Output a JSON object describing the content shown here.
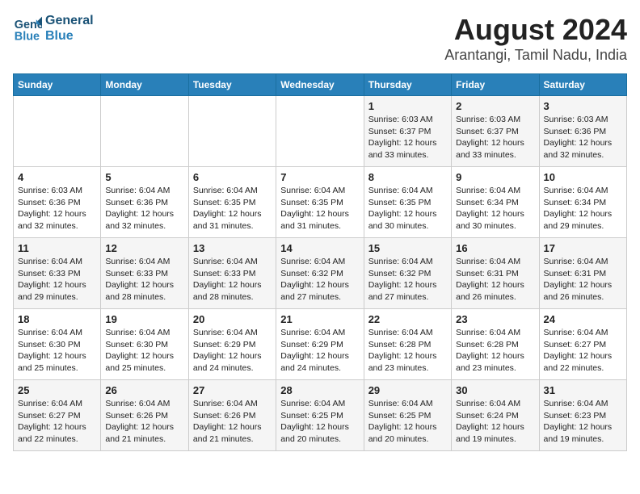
{
  "logo": {
    "line1": "General",
    "line2": "Blue"
  },
  "title": "August 2024",
  "subtitle": "Arantangi, Tamil Nadu, India",
  "days_of_week": [
    "Sunday",
    "Monday",
    "Tuesday",
    "Wednesday",
    "Thursday",
    "Friday",
    "Saturday"
  ],
  "weeks": [
    [
      {
        "day": "",
        "info": ""
      },
      {
        "day": "",
        "info": ""
      },
      {
        "day": "",
        "info": ""
      },
      {
        "day": "",
        "info": ""
      },
      {
        "day": "1",
        "info": "Sunrise: 6:03 AM\nSunset: 6:37 PM\nDaylight: 12 hours\nand 33 minutes."
      },
      {
        "day": "2",
        "info": "Sunrise: 6:03 AM\nSunset: 6:37 PM\nDaylight: 12 hours\nand 33 minutes."
      },
      {
        "day": "3",
        "info": "Sunrise: 6:03 AM\nSunset: 6:36 PM\nDaylight: 12 hours\nand 32 minutes."
      }
    ],
    [
      {
        "day": "4",
        "info": "Sunrise: 6:03 AM\nSunset: 6:36 PM\nDaylight: 12 hours\nand 32 minutes."
      },
      {
        "day": "5",
        "info": "Sunrise: 6:04 AM\nSunset: 6:36 PM\nDaylight: 12 hours\nand 32 minutes."
      },
      {
        "day": "6",
        "info": "Sunrise: 6:04 AM\nSunset: 6:35 PM\nDaylight: 12 hours\nand 31 minutes."
      },
      {
        "day": "7",
        "info": "Sunrise: 6:04 AM\nSunset: 6:35 PM\nDaylight: 12 hours\nand 31 minutes."
      },
      {
        "day": "8",
        "info": "Sunrise: 6:04 AM\nSunset: 6:35 PM\nDaylight: 12 hours\nand 30 minutes."
      },
      {
        "day": "9",
        "info": "Sunrise: 6:04 AM\nSunset: 6:34 PM\nDaylight: 12 hours\nand 30 minutes."
      },
      {
        "day": "10",
        "info": "Sunrise: 6:04 AM\nSunset: 6:34 PM\nDaylight: 12 hours\nand 29 minutes."
      }
    ],
    [
      {
        "day": "11",
        "info": "Sunrise: 6:04 AM\nSunset: 6:33 PM\nDaylight: 12 hours\nand 29 minutes."
      },
      {
        "day": "12",
        "info": "Sunrise: 6:04 AM\nSunset: 6:33 PM\nDaylight: 12 hours\nand 28 minutes."
      },
      {
        "day": "13",
        "info": "Sunrise: 6:04 AM\nSunset: 6:33 PM\nDaylight: 12 hours\nand 28 minutes."
      },
      {
        "day": "14",
        "info": "Sunrise: 6:04 AM\nSunset: 6:32 PM\nDaylight: 12 hours\nand 27 minutes."
      },
      {
        "day": "15",
        "info": "Sunrise: 6:04 AM\nSunset: 6:32 PM\nDaylight: 12 hours\nand 27 minutes."
      },
      {
        "day": "16",
        "info": "Sunrise: 6:04 AM\nSunset: 6:31 PM\nDaylight: 12 hours\nand 26 minutes."
      },
      {
        "day": "17",
        "info": "Sunrise: 6:04 AM\nSunset: 6:31 PM\nDaylight: 12 hours\nand 26 minutes."
      }
    ],
    [
      {
        "day": "18",
        "info": "Sunrise: 6:04 AM\nSunset: 6:30 PM\nDaylight: 12 hours\nand 25 minutes."
      },
      {
        "day": "19",
        "info": "Sunrise: 6:04 AM\nSunset: 6:30 PM\nDaylight: 12 hours\nand 25 minutes."
      },
      {
        "day": "20",
        "info": "Sunrise: 6:04 AM\nSunset: 6:29 PM\nDaylight: 12 hours\nand 24 minutes."
      },
      {
        "day": "21",
        "info": "Sunrise: 6:04 AM\nSunset: 6:29 PM\nDaylight: 12 hours\nand 24 minutes."
      },
      {
        "day": "22",
        "info": "Sunrise: 6:04 AM\nSunset: 6:28 PM\nDaylight: 12 hours\nand 23 minutes."
      },
      {
        "day": "23",
        "info": "Sunrise: 6:04 AM\nSunset: 6:28 PM\nDaylight: 12 hours\nand 23 minutes."
      },
      {
        "day": "24",
        "info": "Sunrise: 6:04 AM\nSunset: 6:27 PM\nDaylight: 12 hours\nand 22 minutes."
      }
    ],
    [
      {
        "day": "25",
        "info": "Sunrise: 6:04 AM\nSunset: 6:27 PM\nDaylight: 12 hours\nand 22 minutes."
      },
      {
        "day": "26",
        "info": "Sunrise: 6:04 AM\nSunset: 6:26 PM\nDaylight: 12 hours\nand 21 minutes."
      },
      {
        "day": "27",
        "info": "Sunrise: 6:04 AM\nSunset: 6:26 PM\nDaylight: 12 hours\nand 21 minutes."
      },
      {
        "day": "28",
        "info": "Sunrise: 6:04 AM\nSunset: 6:25 PM\nDaylight: 12 hours\nand 20 minutes."
      },
      {
        "day": "29",
        "info": "Sunrise: 6:04 AM\nSunset: 6:25 PM\nDaylight: 12 hours\nand 20 minutes."
      },
      {
        "day": "30",
        "info": "Sunrise: 6:04 AM\nSunset: 6:24 PM\nDaylight: 12 hours\nand 19 minutes."
      },
      {
        "day": "31",
        "info": "Sunrise: 6:04 AM\nSunset: 6:23 PM\nDaylight: 12 hours\nand 19 minutes."
      }
    ]
  ]
}
